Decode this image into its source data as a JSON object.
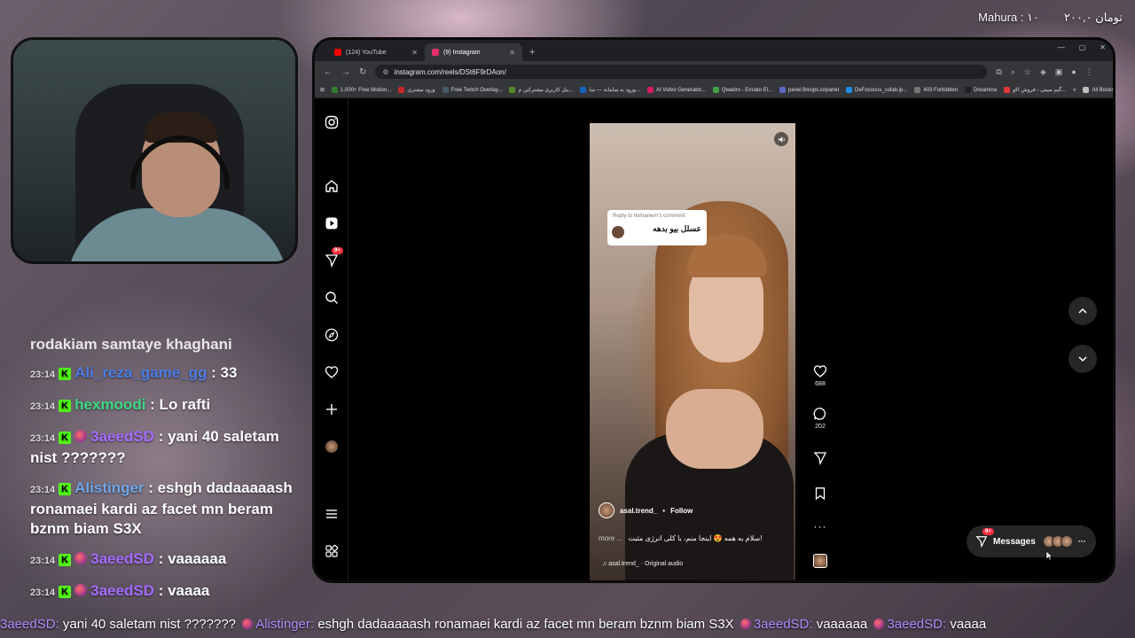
{
  "overlay": {
    "right_text": "۲۰۰,۰ تومان",
    "donor": "Mahura : ۱۰"
  },
  "chat": {
    "partial_top": "rodakiam samtaye khaghani",
    "messages": [
      {
        "time": "23:14",
        "user": "Ali_reza_game_gg",
        "text": ": 33",
        "badge2": false,
        "cls": "u1"
      },
      {
        "time": "23:14",
        "user": "hexmoodi",
        "text": ": Lo rafti",
        "badge2": false,
        "cls": "u2"
      },
      {
        "time": "23:14",
        "user": "3aeedSD",
        "text": ": yani 40 saletam nist ???????",
        "badge2": true,
        "cls": "u3"
      },
      {
        "time": "23:14",
        "user": "Alistinger",
        "text": ": eshgh dadaaaaash ronamaei kardi az facet mn beram bznm biam S3X",
        "badge2": false,
        "cls": "u4"
      },
      {
        "time": "23:14",
        "user": "3aeedSD",
        "text": ": vaaaaaa",
        "badge2": true,
        "cls": "u3"
      },
      {
        "time": "23:14",
        "user": "3aeedSD",
        "text": ": vaaaa",
        "badge2": true,
        "cls": "u3"
      }
    ],
    "badge_letter": "K"
  },
  "ticker": [
    {
      "user": "3aeedSD:",
      "text": " yani 40 saletam nist ??????? "
    },
    {
      "user": "Alistinger:",
      "text": " eshgh dadaaaaash ronamaei kardi az facet mn beram bznm biam S3X "
    },
    {
      "user": "3aeedSD:",
      "text": " vaaaaaa "
    },
    {
      "user": "3aeedSD:",
      "text": " vaaaa"
    }
  ],
  "browser": {
    "tabs": [
      {
        "label": "(124) YouTube",
        "color": "#ff0000",
        "active": false
      },
      {
        "label": "(9) Instagram",
        "color": "#e1306c",
        "active": true
      }
    ],
    "url": "instagram.com/reels/DSt6F9rDAon/",
    "bookmarks": [
      "1,000+ Free Motion...",
      "ورود مشتری",
      "Free Twitch Overlay...",
      "پنل کاربری مشترکین م...",
      "ورود به سامانه — سا...",
      "AI Video Generator...",
      "Qwadro - Envato El...",
      "panel.fireops.io/panel",
      "DeFococus_colab.ip...",
      "403 Forbidden",
      "Dreamina",
      "گیم سیتی - فروش اکو..."
    ],
    "all_bookmarks": "All Bookmarks"
  },
  "instagram": {
    "notif_count": "9+",
    "reply_card": {
      "top": "Reply to homanwm's comment",
      "text": "عسلل بیو بدهه"
    },
    "username": "asal.trend_",
    "follow": "Follow",
    "caption_more": "more ...",
    "caption": "سلام به همه 😍 اینجا منم، با کلی انرژی مثبت!",
    "audio": "asal.trend_ · Original audio",
    "likes": "688",
    "comments": "202",
    "messages_label": "Messages",
    "messages_badge": "9+"
  },
  "colors": {
    "accent": "#53fc18",
    "ig_red": "#ff3040",
    "chat_purple": "#a66cff"
  },
  "icons": [
    "instagram-icon",
    "home-icon",
    "reels-icon",
    "send-icon",
    "search-icon",
    "explore-icon",
    "heart-icon",
    "plus-icon",
    "menu-icon",
    "threads-icon",
    "comment-icon",
    "bookmark-icon",
    "more-icon",
    "chevron-up-icon",
    "chevron-down-icon",
    "volume-icon"
  ]
}
